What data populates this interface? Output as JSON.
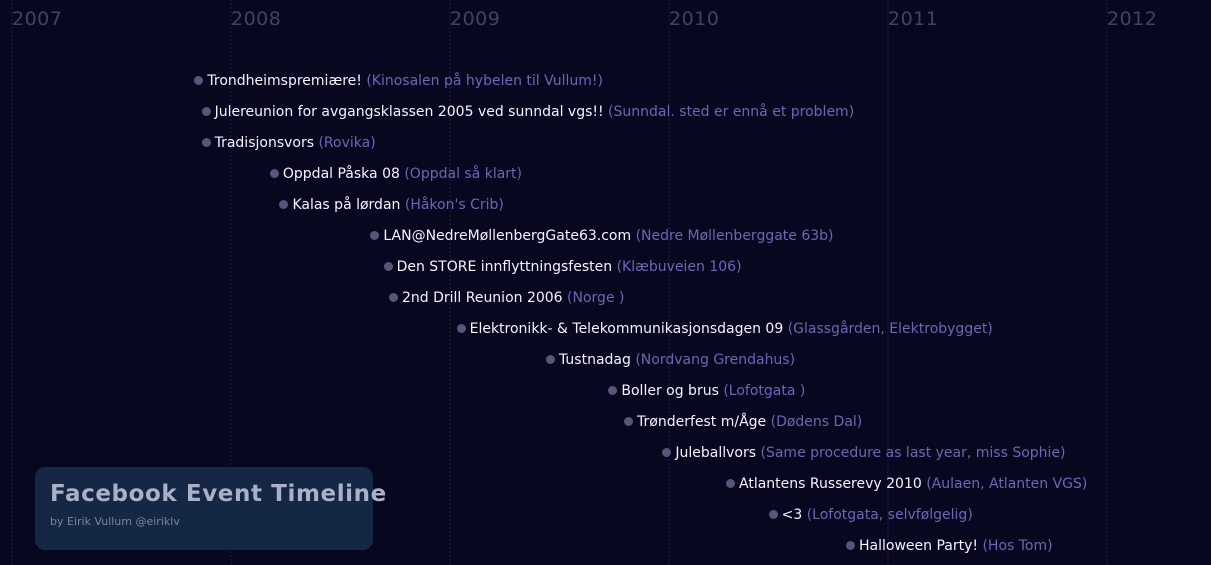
{
  "app": {
    "title": "Facebook Event Timeline",
    "byline": "by Eirik Vullum @eiriklv"
  },
  "years": [
    "2007",
    "2008",
    "2009",
    "2010",
    "2011",
    "2012"
  ],
  "events": [
    {
      "title": "Trondheimspremiære!",
      "location": "(Kinosalen på hybelen til Vullum!)",
      "date": "2007-11-01",
      "span_days": 8
    },
    {
      "title": "Julereunion for avgangsklassen 2005 ved sunndal vgs!!",
      "location": "(Sunndal. sted er ennå et problem)",
      "date": "2007-11-13",
      "span_days": 8
    },
    {
      "title": "Tradisjonsvors",
      "location": "(Rovika)",
      "date": "2007-11-13",
      "span_days": 8
    },
    {
      "title": "Oppdal Påska 08",
      "location": "(Oppdal så klart)",
      "date": "2008-03-06",
      "span_days": 14
    },
    {
      "title": "Kalas på lørdan",
      "location": "(Håkon's Crib)",
      "date": "2008-03-22",
      "span_days": 8
    },
    {
      "title": "LAN@NedreMøllenbergGate63.com",
      "location": "(Nedre Møllenberggate 63b)",
      "date": "2008-08-21",
      "span_days": 8
    },
    {
      "title": "Den STORE innflyttningsfesten",
      "location": "(Klæbuveien 106)",
      "date": "2008-09-12",
      "span_days": 8
    },
    {
      "title": "2nd Drill Reunion 2006",
      "location": "(Norge )",
      "date": "2008-09-21",
      "span_days": 8
    },
    {
      "title": "Elektronikk- & Telekommunikasjonsdagen 09",
      "location": "(Glassgården, Elektrobygget)",
      "date": "2009-01-12",
      "span_days": 8
    },
    {
      "title": "Tustnadag",
      "location": "(Nordvang Grendahus)",
      "date": "2009-06-10",
      "span_days": 8
    },
    {
      "title": "Boller og brus",
      "location": "(Lofotgata )",
      "date": "2009-09-22",
      "span_days": 8
    },
    {
      "title": "Trønderfest m/Åge",
      "location": "(Dødens Dal)",
      "date": "2009-10-18",
      "span_days": 8
    },
    {
      "title": "Juleballvors",
      "location": "(Same procedure as last year, miss Sophie)",
      "date": "2009-12-21",
      "span_days": 8
    },
    {
      "title": "Atlantens Russerevy 2010",
      "location": "(Aulaen, Atlanten VGS)",
      "date": "2010-04-06",
      "span_days": 8
    },
    {
      "title": "<3",
      "location": "(Lofotgata, selvfølgelig)",
      "date": "2010-06-16",
      "span_days": 8
    },
    {
      "title": "Halloween Party!",
      "location": "(Hos Tom)",
      "date": "2010-10-23",
      "span_days": 8
    }
  ]
}
